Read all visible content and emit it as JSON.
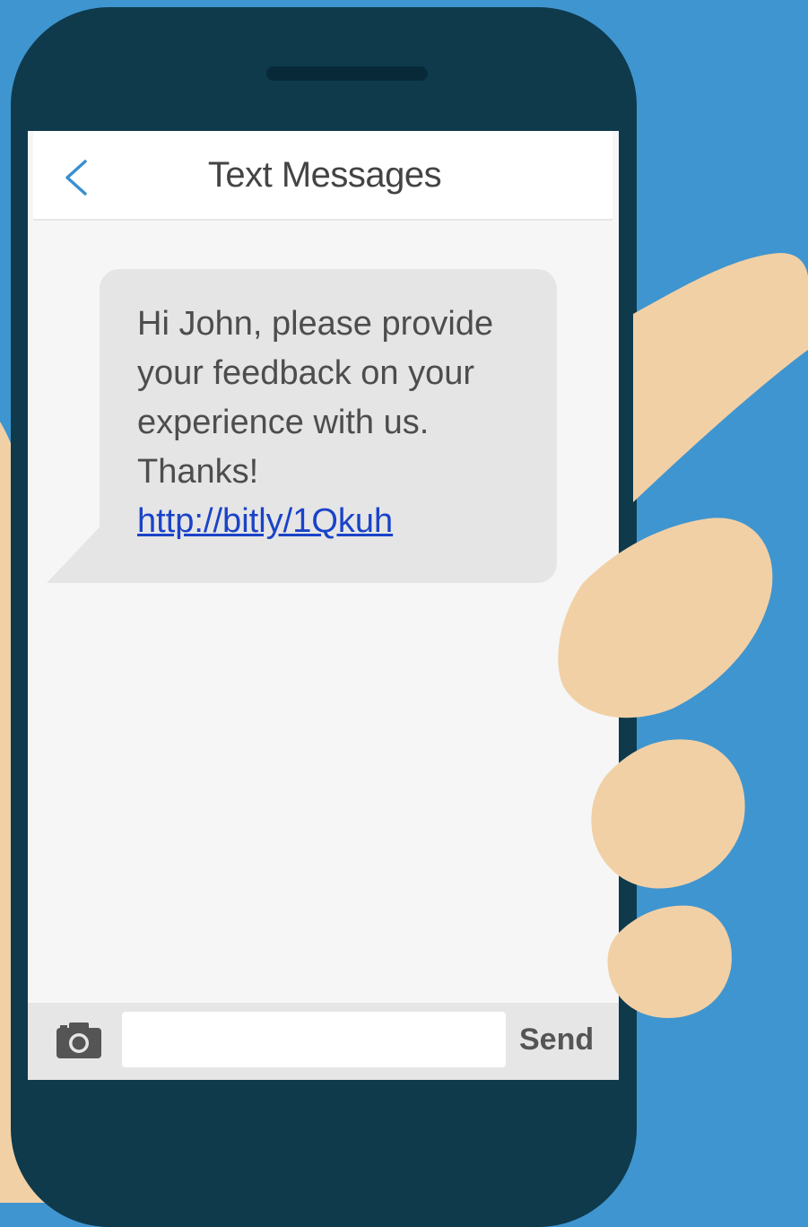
{
  "colors": {
    "background": "#3f95cf",
    "phone_body": "#0e3a4c",
    "skin": "#f2d0a5",
    "bubble": "#e5e5e5",
    "link": "#1a43c8"
  },
  "header": {
    "back_icon": "chevron-left-icon",
    "title": "Text Messages"
  },
  "message": {
    "lines": [
      "Hi John, please provide",
      "your feedback on your",
      "experience with us.",
      "Thanks!"
    ],
    "link": "http://bitly/1Qkuh"
  },
  "compose": {
    "camera_icon": "camera-icon",
    "input_value": "",
    "send_label": "Send"
  }
}
